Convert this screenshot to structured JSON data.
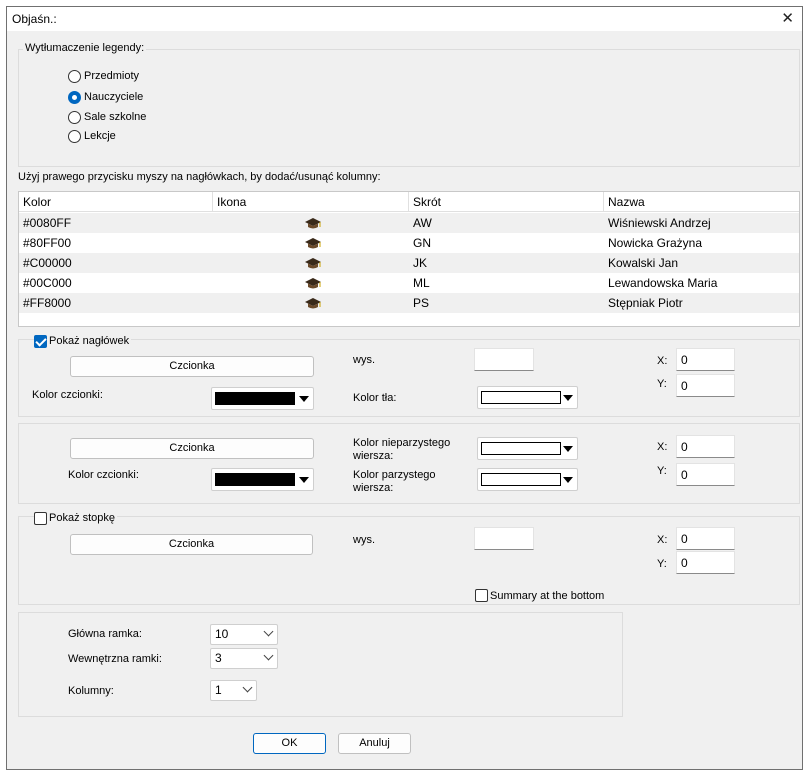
{
  "window": {
    "title": "Objaśn.:",
    "close_glyph": "✕"
  },
  "legend": {
    "group_label": "Wytłumaczenie legendy:",
    "options": [
      {
        "label": "Przedmioty",
        "checked": false
      },
      {
        "label": "Nauczyciele",
        "checked": true
      },
      {
        "label": "Sale szkolne",
        "checked": false
      },
      {
        "label": "Lekcje",
        "checked": false
      }
    ]
  },
  "table": {
    "hint": "Użyj prawego przycisku myszy na nagłówkach, by dodać/usunąć kolumny:",
    "columns": [
      "Kolor",
      "Ikona",
      "Skrót",
      "Nazwa"
    ],
    "icon_name": "graduation-cap-icon",
    "rows": [
      {
        "color": "#0080FF",
        "abbr": "AW",
        "name": "Wiśniewski Andrzej"
      },
      {
        "color": "#80FF00",
        "abbr": "GN",
        "name": "Nowicka Grażyna"
      },
      {
        "color": "#C00000",
        "abbr": "JK",
        "name": "Kowalski Jan"
      },
      {
        "color": "#00C000",
        "abbr": "ML",
        "name": "Lewandowska Maria"
      },
      {
        "color": "#FF8000",
        "abbr": "PS",
        "name": "Stępniak Piotr"
      }
    ]
  },
  "header_section": {
    "show_label": "Pokaż nagłówek",
    "show_checked": true,
    "font_button": "Czcionka",
    "height_label": "wys.",
    "height_value": "",
    "font_color_label": "Kolor czcionki:",
    "font_color": "#000000",
    "bg_color_label": "Kolor tła:",
    "bg_color": "#FFFFFF",
    "x_label": "X:",
    "x_value": "0",
    "y_label": "Y:",
    "y_value": "0"
  },
  "rows_section": {
    "font_button": "Czcionka",
    "font_color_label": "Kolor czcionki:",
    "font_color": "#000000",
    "odd_row_label": "Kolor nieparzystego wiersza:",
    "odd_row_color": "#FFFFFF",
    "even_row_label": "Kolor parzystego wiersza:",
    "even_row_color": "#FFFFFF",
    "x_label": "X:",
    "x_value": "0",
    "y_label": "Y:",
    "y_value": "0"
  },
  "footer_section": {
    "show_label": "Pokaż stopkę",
    "show_checked": false,
    "font_button": "Czcionka",
    "height_label": "wys.",
    "height_value": "",
    "x_label": "X:",
    "x_value": "0",
    "y_label": "Y:",
    "y_value": "0",
    "summary_label": "Summary at the bottom",
    "summary_checked": false
  },
  "frame_section": {
    "main_frame_label": "Główna ramka:",
    "main_frame_value": "10",
    "inner_frame_label": "Wewnętrzna ramki:",
    "inner_frame_value": "3",
    "columns_label": "Kolumny:",
    "columns_value": "1"
  },
  "buttons": {
    "ok": "OK",
    "cancel": "Anuluj"
  }
}
